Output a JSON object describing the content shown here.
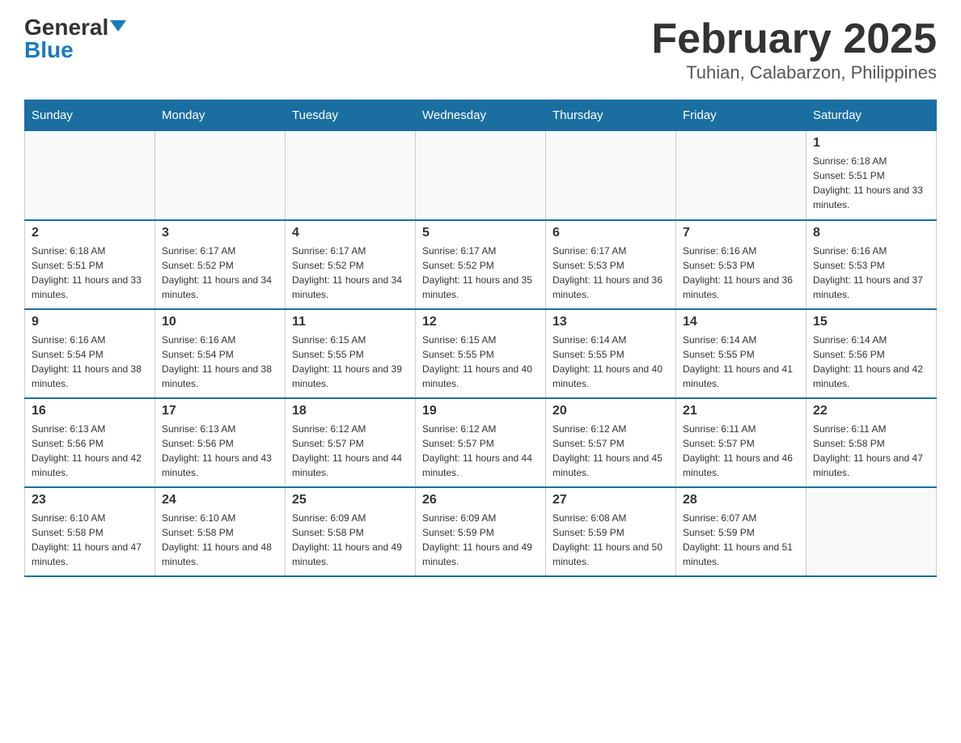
{
  "logo": {
    "general": "General",
    "blue": "Blue"
  },
  "header": {
    "month_year": "February 2025",
    "location": "Tuhian, Calabarzon, Philippines"
  },
  "days_of_week": [
    "Sunday",
    "Monday",
    "Tuesday",
    "Wednesday",
    "Thursday",
    "Friday",
    "Saturday"
  ],
  "weeks": [
    [
      {
        "day": "",
        "info": ""
      },
      {
        "day": "",
        "info": ""
      },
      {
        "day": "",
        "info": ""
      },
      {
        "day": "",
        "info": ""
      },
      {
        "day": "",
        "info": ""
      },
      {
        "day": "",
        "info": ""
      },
      {
        "day": "1",
        "info": "Sunrise: 6:18 AM\nSunset: 5:51 PM\nDaylight: 11 hours and 33 minutes."
      }
    ],
    [
      {
        "day": "2",
        "info": "Sunrise: 6:18 AM\nSunset: 5:51 PM\nDaylight: 11 hours and 33 minutes."
      },
      {
        "day": "3",
        "info": "Sunrise: 6:17 AM\nSunset: 5:52 PM\nDaylight: 11 hours and 34 minutes."
      },
      {
        "day": "4",
        "info": "Sunrise: 6:17 AM\nSunset: 5:52 PM\nDaylight: 11 hours and 34 minutes."
      },
      {
        "day": "5",
        "info": "Sunrise: 6:17 AM\nSunset: 5:52 PM\nDaylight: 11 hours and 35 minutes."
      },
      {
        "day": "6",
        "info": "Sunrise: 6:17 AM\nSunset: 5:53 PM\nDaylight: 11 hours and 36 minutes."
      },
      {
        "day": "7",
        "info": "Sunrise: 6:16 AM\nSunset: 5:53 PM\nDaylight: 11 hours and 36 minutes."
      },
      {
        "day": "8",
        "info": "Sunrise: 6:16 AM\nSunset: 5:53 PM\nDaylight: 11 hours and 37 minutes."
      }
    ],
    [
      {
        "day": "9",
        "info": "Sunrise: 6:16 AM\nSunset: 5:54 PM\nDaylight: 11 hours and 38 minutes."
      },
      {
        "day": "10",
        "info": "Sunrise: 6:16 AM\nSunset: 5:54 PM\nDaylight: 11 hours and 38 minutes."
      },
      {
        "day": "11",
        "info": "Sunrise: 6:15 AM\nSunset: 5:55 PM\nDaylight: 11 hours and 39 minutes."
      },
      {
        "day": "12",
        "info": "Sunrise: 6:15 AM\nSunset: 5:55 PM\nDaylight: 11 hours and 40 minutes."
      },
      {
        "day": "13",
        "info": "Sunrise: 6:14 AM\nSunset: 5:55 PM\nDaylight: 11 hours and 40 minutes."
      },
      {
        "day": "14",
        "info": "Sunrise: 6:14 AM\nSunset: 5:55 PM\nDaylight: 11 hours and 41 minutes."
      },
      {
        "day": "15",
        "info": "Sunrise: 6:14 AM\nSunset: 5:56 PM\nDaylight: 11 hours and 42 minutes."
      }
    ],
    [
      {
        "day": "16",
        "info": "Sunrise: 6:13 AM\nSunset: 5:56 PM\nDaylight: 11 hours and 42 minutes."
      },
      {
        "day": "17",
        "info": "Sunrise: 6:13 AM\nSunset: 5:56 PM\nDaylight: 11 hours and 43 minutes."
      },
      {
        "day": "18",
        "info": "Sunrise: 6:12 AM\nSunset: 5:57 PM\nDaylight: 11 hours and 44 minutes."
      },
      {
        "day": "19",
        "info": "Sunrise: 6:12 AM\nSunset: 5:57 PM\nDaylight: 11 hours and 44 minutes."
      },
      {
        "day": "20",
        "info": "Sunrise: 6:12 AM\nSunset: 5:57 PM\nDaylight: 11 hours and 45 minutes."
      },
      {
        "day": "21",
        "info": "Sunrise: 6:11 AM\nSunset: 5:57 PM\nDaylight: 11 hours and 46 minutes."
      },
      {
        "day": "22",
        "info": "Sunrise: 6:11 AM\nSunset: 5:58 PM\nDaylight: 11 hours and 47 minutes."
      }
    ],
    [
      {
        "day": "23",
        "info": "Sunrise: 6:10 AM\nSunset: 5:58 PM\nDaylight: 11 hours and 47 minutes."
      },
      {
        "day": "24",
        "info": "Sunrise: 6:10 AM\nSunset: 5:58 PM\nDaylight: 11 hours and 48 minutes."
      },
      {
        "day": "25",
        "info": "Sunrise: 6:09 AM\nSunset: 5:58 PM\nDaylight: 11 hours and 49 minutes."
      },
      {
        "day": "26",
        "info": "Sunrise: 6:09 AM\nSunset: 5:59 PM\nDaylight: 11 hours and 49 minutes."
      },
      {
        "day": "27",
        "info": "Sunrise: 6:08 AM\nSunset: 5:59 PM\nDaylight: 11 hours and 50 minutes."
      },
      {
        "day": "28",
        "info": "Sunrise: 6:07 AM\nSunset: 5:59 PM\nDaylight: 11 hours and 51 minutes."
      },
      {
        "day": "",
        "info": ""
      }
    ]
  ]
}
